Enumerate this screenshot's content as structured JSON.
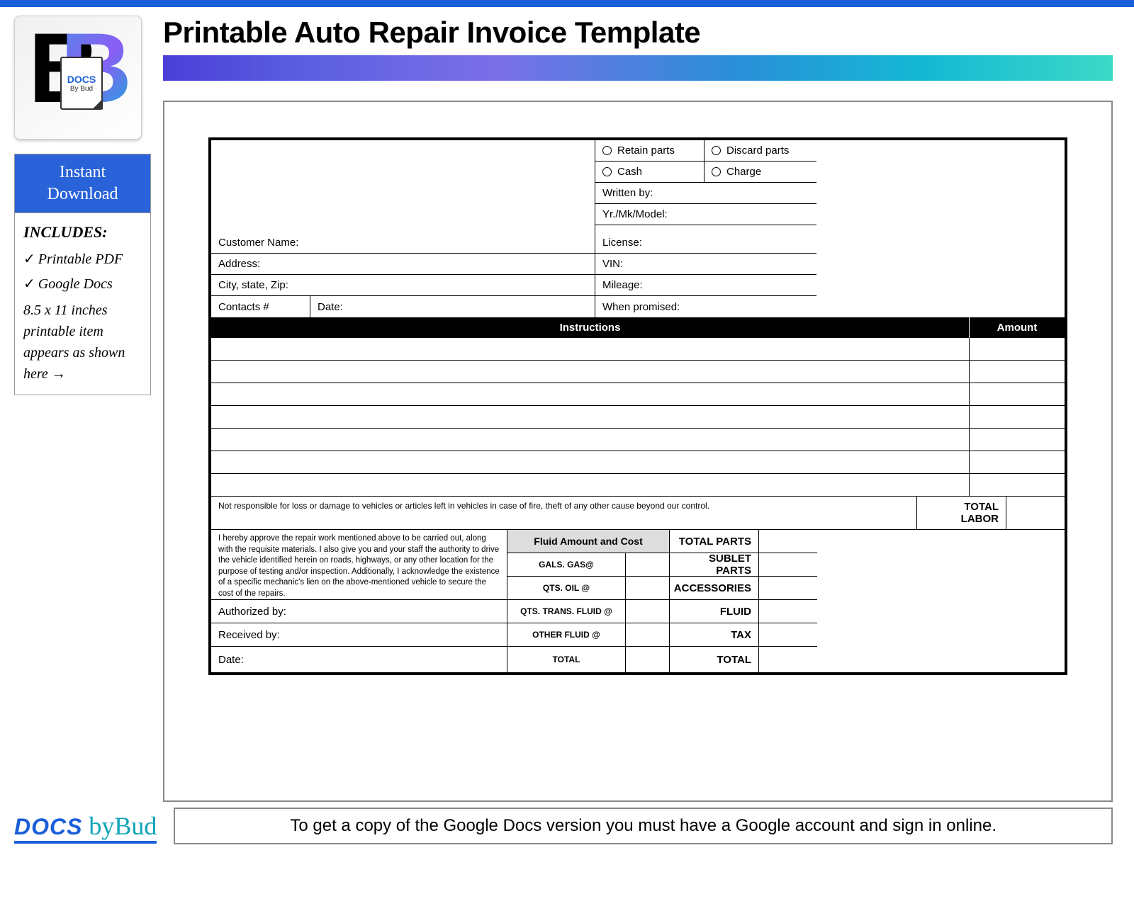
{
  "header": {
    "title": "Printable Auto Repair Invoice Template"
  },
  "sidebar": {
    "logo": {
      "docs": "DOCS",
      "bybud": "By Bud"
    },
    "instant_line1": "Instant",
    "instant_line2": "Download",
    "includes_heading": "INCLUDES:",
    "item1": "Printable PDF",
    "item2": "Google Docs",
    "note": "8.5 x 11 inches printable item appears as shown here →"
  },
  "invoice": {
    "options": {
      "retain": "Retain parts",
      "discard": "Discard parts",
      "cash": "Cash",
      "charge": "Charge"
    },
    "fields": {
      "written_by": "Written by:",
      "yr_mk_model": "Yr./Mk/Model:",
      "customer_name": "Customer Name:",
      "license": "License:",
      "address": "Address:",
      "vin": "VIN:",
      "city_state_zip": "City, state, Zip:",
      "mileage": "Mileage:",
      "contacts": "Contacts #",
      "date": "Date:",
      "when_promised": "When promised:"
    },
    "headers": {
      "instructions": "Instructions",
      "amount": "Amount"
    },
    "disclaimer": "Not responsible for loss or damage to vehicles or articles left in vehicles in case of fire, theft of any other cause beyond our control.",
    "approval": "I hereby approve the repair work mentioned above to be carried out, along with the requisite materials. I also give you and your staff the authority to drive the vehicle identified herein on roads, highways, or any other location for the purpose of testing and/or inspection. Additionally, I acknowledge the existence of a specific mechanic's lien on the above-mentioned vehicle to secure the cost of the repairs.",
    "sig": {
      "authorized": "Authorized by:",
      "received": "Received by:",
      "date": "Date:"
    },
    "fluids": {
      "header": "Fluid Amount and Cost",
      "gas": "GALS. GAS@",
      "oil": "QTS. OIL @",
      "trans": "QTS. TRANS. FLUID @",
      "other": "OTHER FLUID @",
      "total": "TOTAL"
    },
    "totals": {
      "labor": "TOTAL LABOR",
      "parts": "TOTAL PARTS",
      "sublet": "SUBLET PARTS",
      "accessories": "ACCESSORIES",
      "fluid": "FLUID",
      "tax": "TAX",
      "total": "TOTAL"
    }
  },
  "footer": {
    "logo_docs": "DOCS",
    "logo_bybud": "byBud",
    "note": "To get a copy of the Google Docs version you must have a Google account and sign in online."
  }
}
